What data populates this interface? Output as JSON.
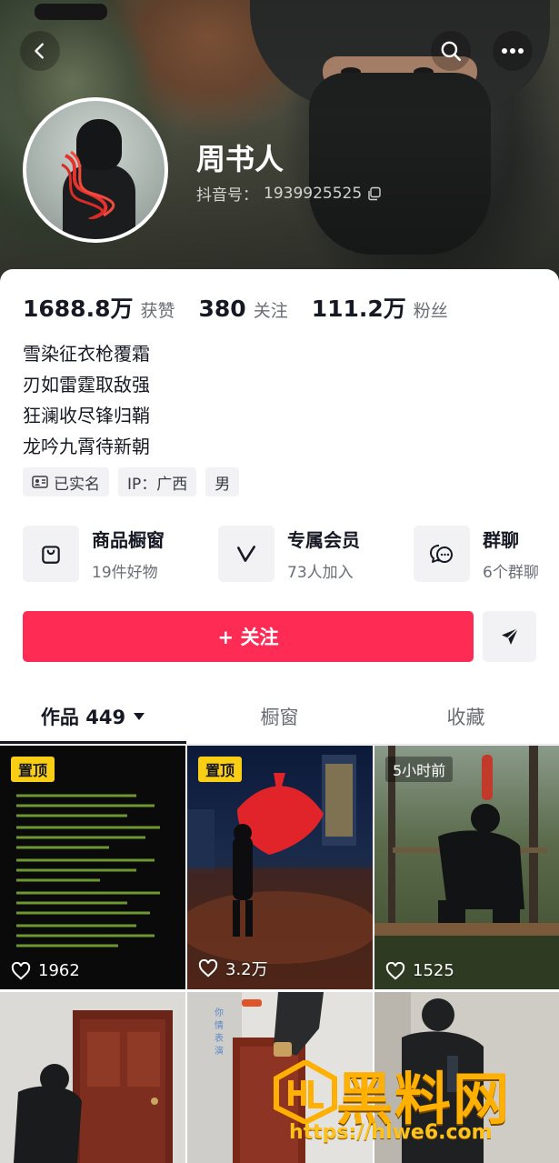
{
  "header": {
    "name": "周书人",
    "douyin_id_label": "抖音号：",
    "douyin_id": "1939925525"
  },
  "stats": [
    {
      "value": "1688.8万",
      "label": "获赞"
    },
    {
      "value": "380",
      "label": "关注"
    },
    {
      "value": "111.2万",
      "label": "粉丝"
    }
  ],
  "bio": [
    "雪染征衣枪覆霜",
    "刃如雷霆取敌强",
    "狂澜收尽锋归鞘",
    "龙吟九霄待新朝"
  ],
  "tags": {
    "verified": "已实名",
    "ip": "IP：广西",
    "gender": "男"
  },
  "features": [
    {
      "title": "商品橱窗",
      "sub": "19件好物",
      "icon": "shopping-bag-icon"
    },
    {
      "title": "专属会员",
      "sub": "73人加入",
      "icon": "v-member-icon"
    },
    {
      "title": "群聊",
      "sub": "6个群聊",
      "icon": "chat-bubble-icon"
    }
  ],
  "follow_button": "+ 关注",
  "tabs": [
    {
      "label": "作品 449"
    },
    {
      "label": "橱窗"
    },
    {
      "label": "收藏"
    }
  ],
  "videos": [
    {
      "badge": "置顶",
      "likes": "1962"
    },
    {
      "badge": "置顶",
      "likes": "3.2万"
    },
    {
      "badge": "5小时前",
      "likes": "1525"
    }
  ],
  "watermark": {
    "text": "黑料网",
    "url": "https://hlwe6.com"
  },
  "colors": {
    "accent": "#fe2c55",
    "pin": "#face15"
  }
}
